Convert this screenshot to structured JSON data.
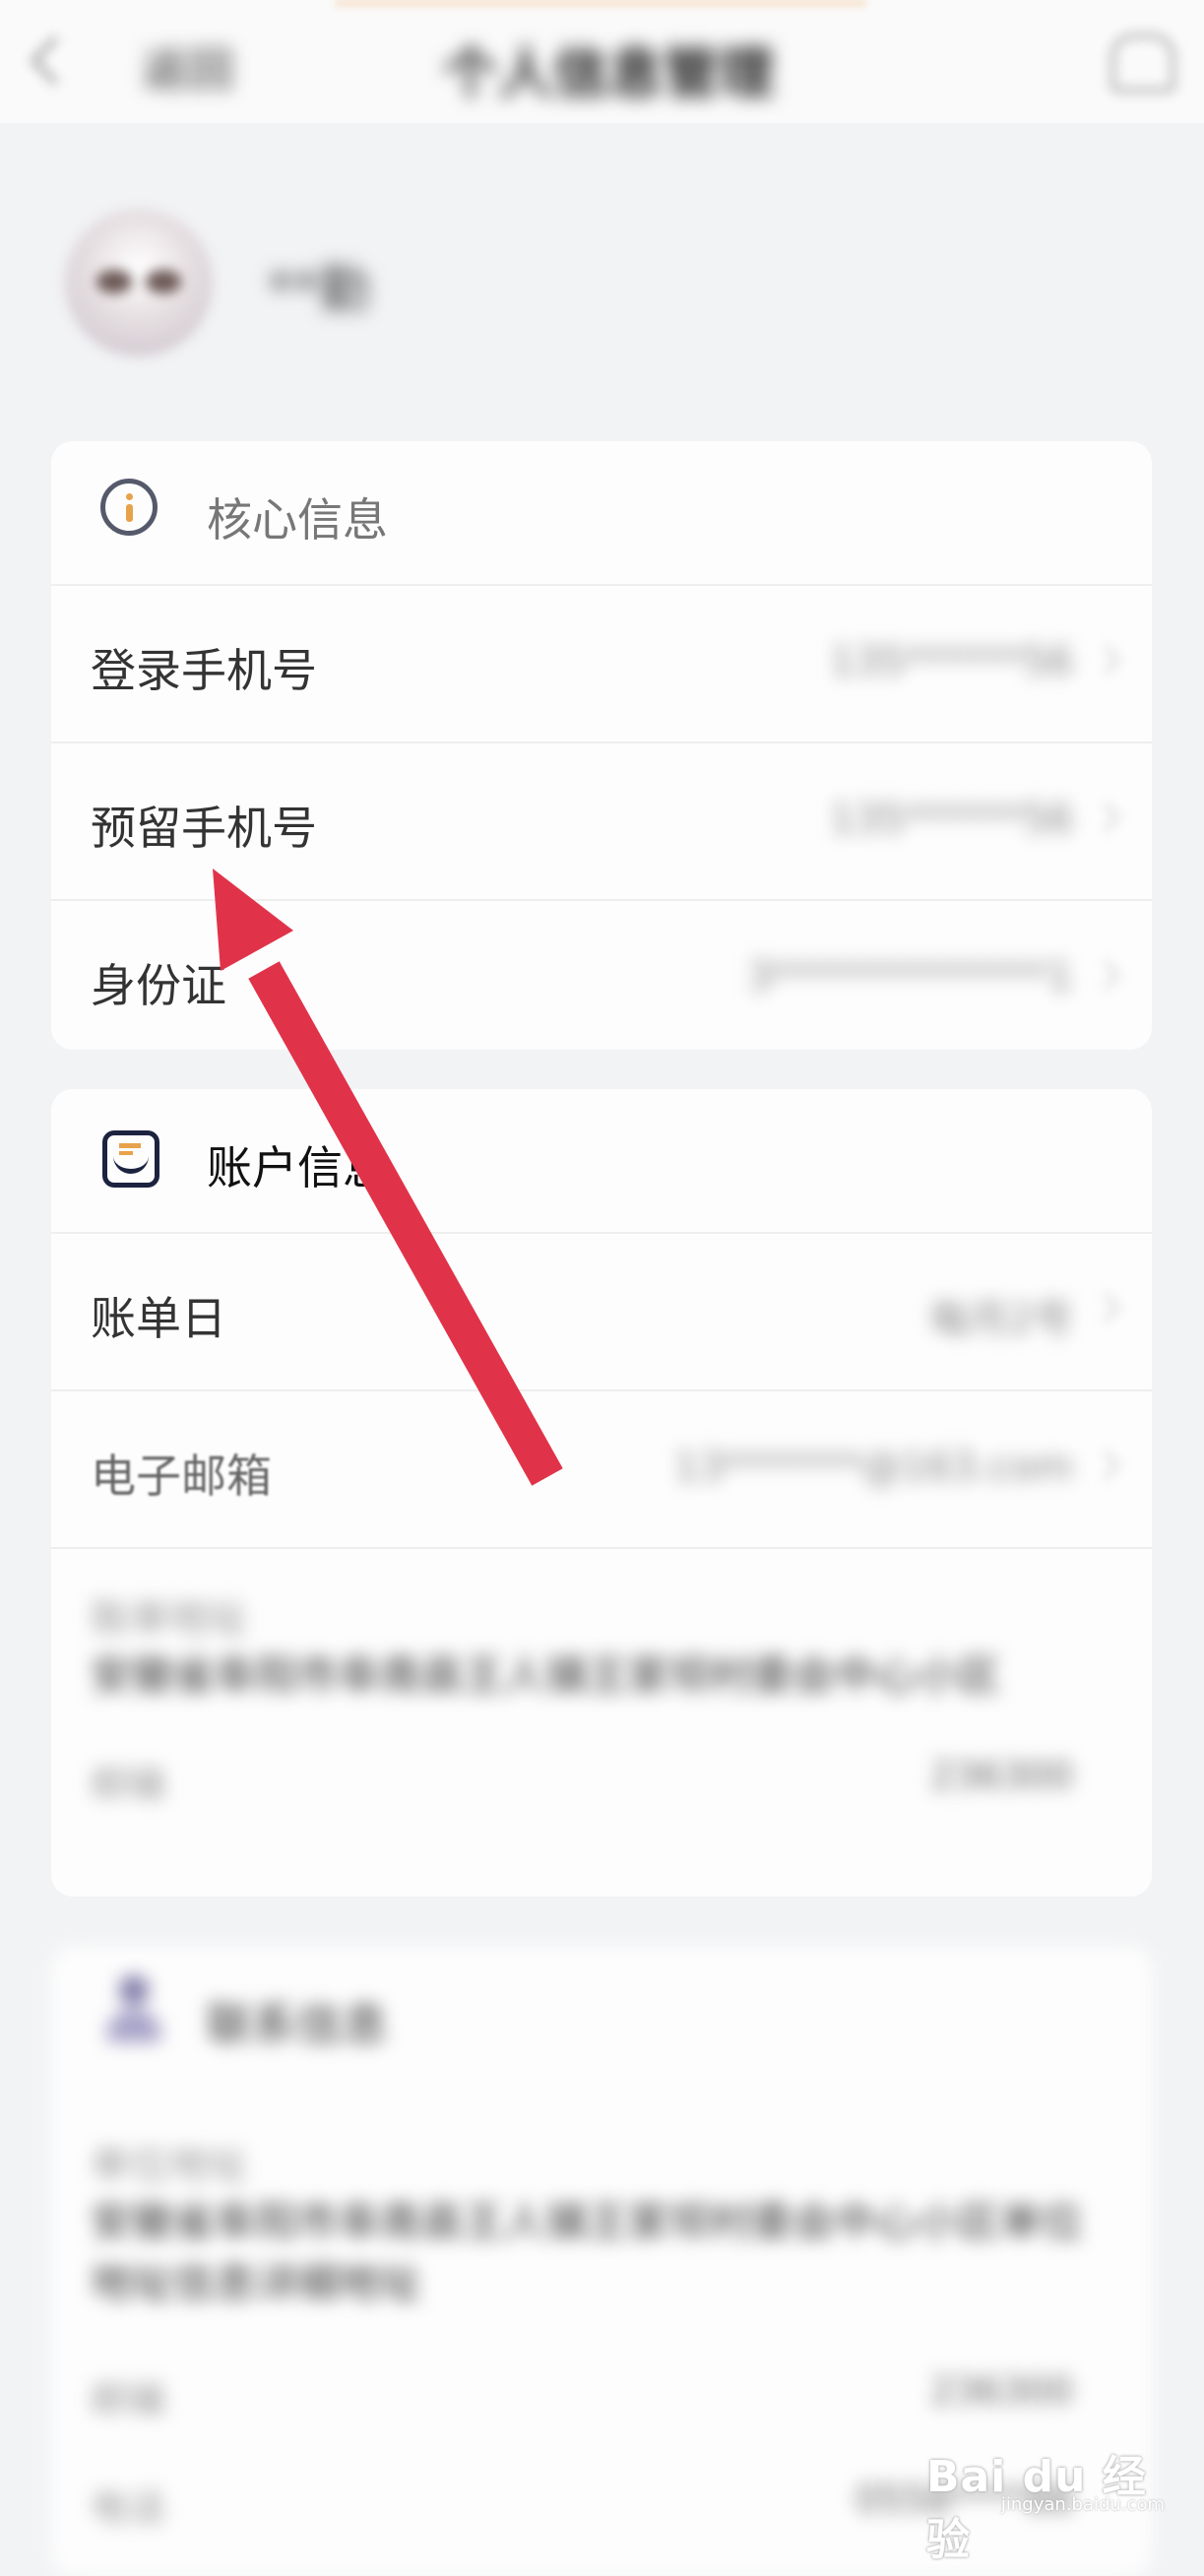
{
  "header": {
    "back_label": "返回",
    "title": "个人信息管理"
  },
  "profile": {
    "username": "**勤"
  },
  "core_info": {
    "title": "核心信息",
    "rows": [
      {
        "label": "登录手机号",
        "value": "135******56"
      },
      {
        "label": "预留手机号",
        "value": "135******56"
      },
      {
        "label": "身份证",
        "value": "3**************1"
      }
    ]
  },
  "account_info": {
    "title": "账户信息",
    "rows": [
      {
        "label": "账单日",
        "value": "每月2号"
      },
      {
        "label": "电子邮箱",
        "value": "13*******@163.com"
      }
    ],
    "bill_address_label": "账单地址",
    "bill_address": "安徽省阜阳市阜南县王人镇王家坝村委会中心小区",
    "postcode_label": "邮编",
    "postcode_value": "236300"
  },
  "contact_info": {
    "title": "联系信息",
    "address_label": "单位地址",
    "address": "安徽省阜阳市阜南县王人镇王家坝村委会中心小区单位地址信息详细地址",
    "postcode_label": "邮编",
    "postcode_value": "236300",
    "extra_label": "电话",
    "extra_value": "0558****88"
  },
  "watermark": {
    "main": "Bai du 经验",
    "sub": "jingyan.baidu.com"
  },
  "colors": {
    "arrow": "#e0334a",
    "background": "#f2f3f5",
    "card": "#fdfdfd"
  }
}
